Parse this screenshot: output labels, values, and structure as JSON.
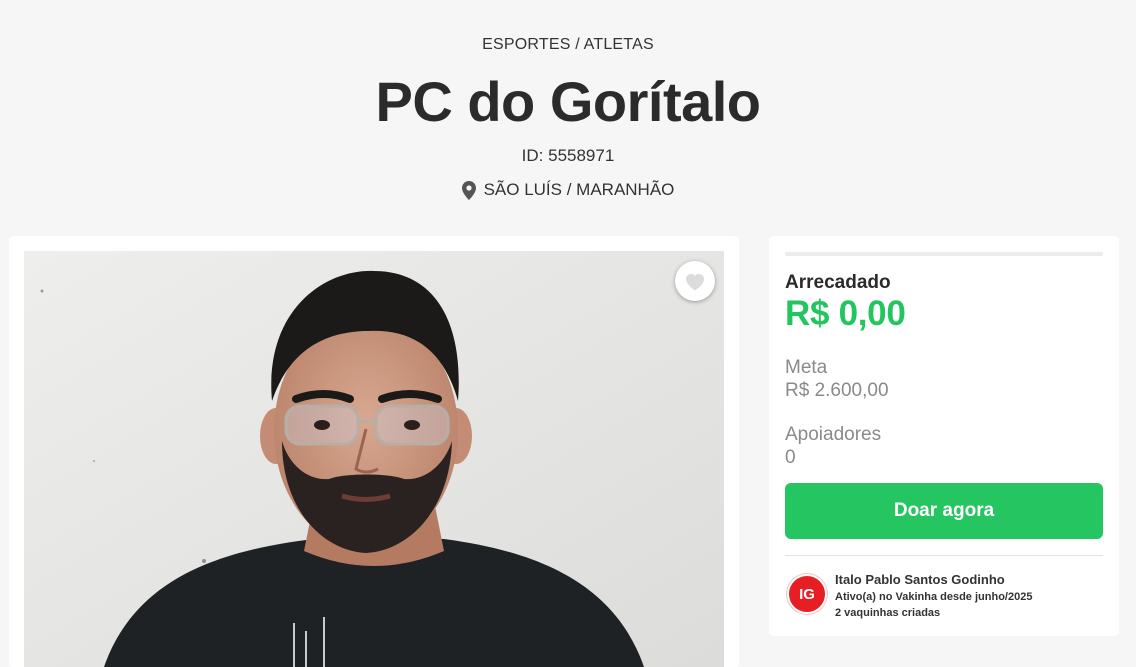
{
  "header": {
    "category": "ESPORTES / ATLETAS",
    "title": "PC do Gorítalo",
    "campaign_id": "ID: 5558971",
    "location": "SÃO LUÍS / MARANHÃO"
  },
  "icons": {
    "location": "location-pin-icon",
    "favorite": "heart-icon"
  },
  "donation": {
    "raised_label": "Arrecadado",
    "raised_value": "R$ 0,00",
    "goal_label": "Meta",
    "goal_value": "R$ 2.600,00",
    "supporters_label": "Apoiadores",
    "supporters_value": "0",
    "donate_button": "Doar agora",
    "progress": 0
  },
  "organizer": {
    "initials": "IG",
    "name": "Italo Pablo Santos Godinho",
    "active_since": "Ativo(a) no Vakinha desde junho/2025",
    "campaigns_created": "2 vaquinhas criadas"
  },
  "colors": {
    "accent": "#22c55e",
    "button": "#25c661",
    "avatar": "#e81e25",
    "background": "#f6f6f6"
  }
}
